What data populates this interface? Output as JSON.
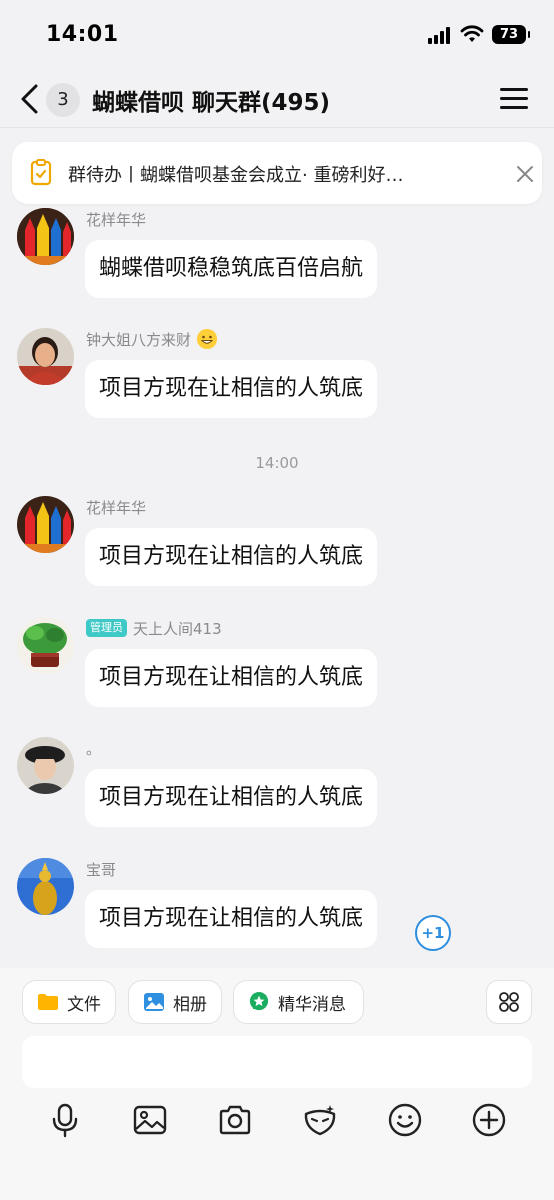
{
  "status": {
    "time": "14:01",
    "battery": "73"
  },
  "nav": {
    "unread_count": "3",
    "title": "蝴蝶借呗 聊天群(495)"
  },
  "announcement": {
    "text": "群待办丨蝴蝶借呗基金会成立· 重磅利好…"
  },
  "time_separator": "14:00",
  "messages": [
    {
      "sender": "花样年华",
      "text": "蝴蝶借呗稳稳筑底百倍启航"
    },
    {
      "sender": "钟大姐八方来财",
      "text": "项目方现在让相信的人筑底"
    },
    {
      "sender": "花样年华",
      "text": "项目方现在让相信的人筑底"
    },
    {
      "sender": "天上人间413",
      "badge": "管理员",
      "text": "项目方现在让相信的人筑底"
    },
    {
      "sender": "。",
      "text": "项目方现在让相信的人筑底"
    },
    {
      "sender": "宝哥",
      "text": "项目方现在让相信的人筑底"
    }
  ],
  "plus_one": "+1",
  "quick_actions": {
    "file": "文件",
    "album": "相册",
    "highlights": "精华消息"
  },
  "input": {
    "value": ""
  },
  "colors": {
    "accent": "#2d8ee0",
    "admin_badge": "#3ec8c6",
    "highlight_green": "#1aad5f",
    "folder_yellow": "#ffb400"
  }
}
